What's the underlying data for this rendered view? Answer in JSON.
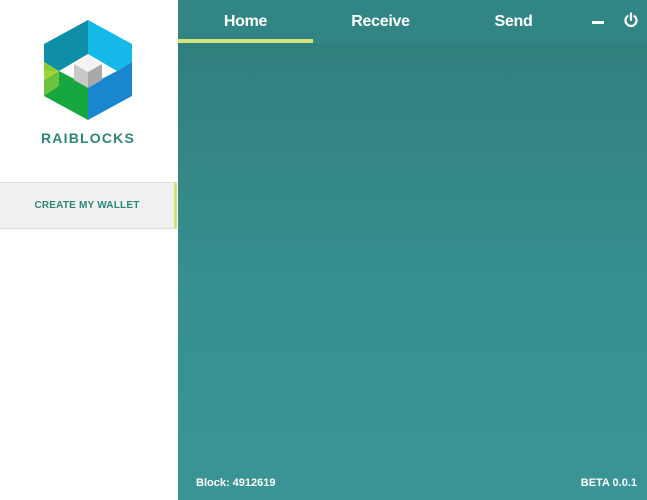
{
  "app": {
    "brand": "RAIBLOCKS",
    "accent_color": "#cfe57a",
    "brand_color": "#2e8577",
    "panel_color": "#318685"
  },
  "sidebar": {
    "logo_icon": "raiblocks-hex-logo-icon",
    "create_wallet_label": "CREATE MY WALLET"
  },
  "tabs": [
    {
      "label": "Home",
      "active": true
    },
    {
      "label": "Receive",
      "active": false
    },
    {
      "label": "Send",
      "active": false
    }
  ],
  "window_controls": {
    "minimize_icon": "minimize-icon",
    "power_icon": "power-icon"
  },
  "footer": {
    "block_text": "Block: 4912619",
    "version_text": "BETA 0.0.1"
  }
}
